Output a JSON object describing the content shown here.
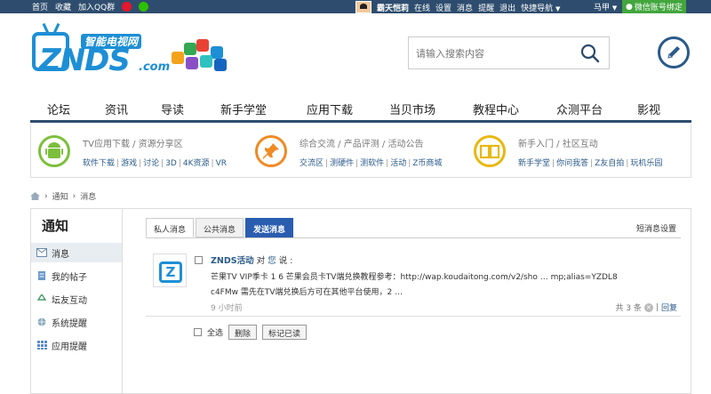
{
  "topbar": {
    "links": [
      "首页",
      "收藏",
      "加入QQ群"
    ],
    "username": "霸天恺莉",
    "user_links": [
      "在线",
      "设置",
      "消息",
      "提醒",
      "退出",
      "快捷导航"
    ],
    "right_user": "马甲",
    "wechat_bind": "微信账号绑定"
  },
  "logo": {
    "word": "ZNDS",
    "dotcom": ".com",
    "slogan": "智能电视网"
  },
  "search": {
    "placeholder": "请输入搜索内容"
  },
  "nav": [
    "论坛",
    "资讯",
    "导读",
    "新手学堂",
    "应用下载",
    "当贝市场",
    "教程中心",
    "众测平台",
    "影视"
  ],
  "categories": [
    {
      "title": "TV应用下载 / 资源分享区",
      "links": [
        "软件下载",
        "游戏",
        "讨论",
        "3D",
        "4K资源",
        "VR"
      ],
      "color": "#7dbf3d"
    },
    {
      "title": "综合交流 / 产品评测 / 活动公告",
      "links": [
        "交流区",
        "测硬件",
        "测软件",
        "活动",
        "Z币商城"
      ],
      "color": "#f08a24"
    },
    {
      "title": "新手入门 / 社区互动",
      "links": [
        "新手学堂",
        "你问我答",
        "Z友自拍",
        "玩机乐园"
      ],
      "color": "#e8b80f"
    }
  ],
  "breadcrumb": [
    "通知",
    "消息"
  ],
  "sidebar": {
    "title": "通知",
    "items": [
      "消息",
      "我的帖子",
      "坛友互动",
      "系统提醒",
      "应用提醒"
    ]
  },
  "tabs": [
    "私人消息",
    "公共消息",
    "发送消息"
  ],
  "settings_link": "短消息设置",
  "message": {
    "sender": "ZNDS活动",
    "to_word": "对",
    "you_word": "您",
    "said": "说 :",
    "line2": "芒果TV VIP季卡 1                  6 芒果会员卡TV端兑换教程参考：http://wap.koudaitong.com/v2/sho … mp;alias=YZDL8",
    "line3": "c4FMw 需先在TV端兑换后方可在其他平台使用，2 …",
    "time": "9 小时前",
    "count": "共 3 条",
    "reply": "回复"
  },
  "actions": {
    "select_all": "全选",
    "delete": "删除",
    "mark_read": "标记已读"
  }
}
